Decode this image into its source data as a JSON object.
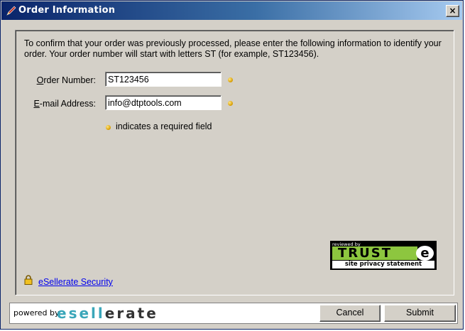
{
  "window": {
    "title": "Order Information",
    "close_glyph": "×"
  },
  "instructions": "To confirm that your order was previously processed, please enter the following information to identify your order. Your order number will start with letters ST (for example, ST123456).",
  "form": {
    "order_number": {
      "label_access": "O",
      "label_rest": "rder Number:",
      "value": "ST123456"
    },
    "email": {
      "label_access": "E",
      "label_rest": "-mail Address:",
      "value": "info@dtptools.com"
    },
    "required_note": "indicates a required field"
  },
  "trust_badge": {
    "top": "reviewed by",
    "main": "TRUST",
    "mark": "e",
    "bottom": "site privacy statement"
  },
  "security_link": "eSellerate Security",
  "footer": {
    "powered_by": "powered by",
    "brand_left": "esell",
    "brand_right": "erate",
    "cancel_label": "Cancel",
    "submit_label": "Submit"
  },
  "colors": {
    "brand_teal": "#3aa6b9",
    "brand_dark": "#333333",
    "required_dot": "#e0a800",
    "link": "#0000ee"
  },
  "icons": [
    "pen-icon",
    "close-icon",
    "lock-icon",
    "required-dot-icon"
  ]
}
